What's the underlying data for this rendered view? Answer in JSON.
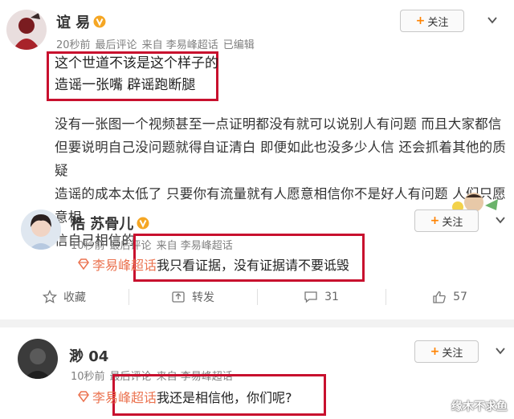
{
  "post1": {
    "username": "谊  易",
    "meta": [
      "20秒前",
      "最后评论",
      "来自 李易峰超话",
      "已编辑"
    ],
    "follow_label": "关注",
    "highlight_lines": [
      "这个世道不该是这个样子的",
      "造谣一张嘴 辟谣跑断腿"
    ],
    "body_lines": [
      "没有一张图一个视频甚至一点证明都没有就可以说别人有问题 而且大家都信",
      "但要说明自己没问题就得自证清白 即便如此也没多少人信 还会抓着其他的质疑",
      "造谣的成本太低了 只要你有流量就有人愿意相信你不是好人有问题 人们只愿意相",
      "信自己相信的"
    ]
  },
  "post2": {
    "username": "梏    苏骨儿",
    "meta": [
      "10秒前",
      "最后评论",
      "来自 李易峰超话"
    ],
    "follow_label": "关注",
    "topic": "李易峰超话",
    "text": "我只看证据，没有证据请不要诋毁"
  },
  "actions": {
    "collect": "收藏",
    "repost": "转发",
    "comment_count": "31",
    "like_count": "57"
  },
  "post3": {
    "username": "渺    04",
    "meta": [
      "10秒前",
      "最后评论",
      "来自 李易峰超话"
    ],
    "follow_label": "关注",
    "topic": "李易峰超话",
    "text": "我还是相信他，你们呢?"
  },
  "watermark": "缘木不求鱼",
  "colors": {
    "accent_orange": "#ff8200",
    "topic_orange": "#eb7350",
    "highlight_red": "#c8102e",
    "verified_gold": "#f5a623"
  }
}
